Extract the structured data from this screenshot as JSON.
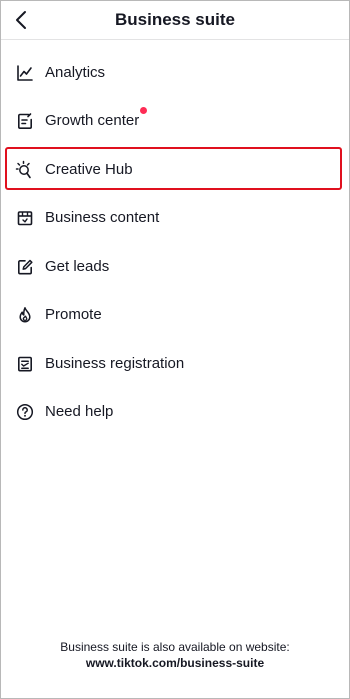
{
  "header": {
    "title": "Business suite",
    "back_icon": "chevron-left-icon"
  },
  "menu": {
    "items": [
      {
        "label": "Analytics",
        "icon": "chart-line-icon"
      },
      {
        "label": "Growth center",
        "icon": "notepad-icon",
        "badge": "red-dot"
      },
      {
        "label": "Creative Hub",
        "icon": "lightbulb-icon",
        "highlighted": true
      },
      {
        "label": "Business content",
        "icon": "store-icon"
      },
      {
        "label": "Get leads",
        "icon": "edit-icon"
      },
      {
        "label": "Promote",
        "icon": "flame-icon"
      },
      {
        "label": "Business registration",
        "icon": "registration-icon"
      },
      {
        "label": "Need help",
        "icon": "help-circle-icon"
      }
    ]
  },
  "footer": {
    "text": "Business suite is also available on website:",
    "url": "www.tiktok.com/business-suite"
  },
  "colors": {
    "text": "#161823",
    "highlight_border": "#e0101e",
    "badge": "#fe2c55"
  }
}
